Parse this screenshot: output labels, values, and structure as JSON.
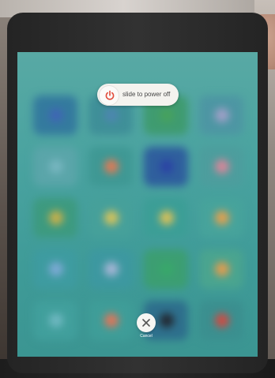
{
  "power_off": {
    "slider_label": "slide to power off",
    "cancel_label": "Cancel"
  },
  "icons": {
    "power": "power-icon",
    "cancel": "close-icon"
  },
  "colors": {
    "screen_tint": "#4aa3a0",
    "power_icon": "#e24b3b"
  }
}
